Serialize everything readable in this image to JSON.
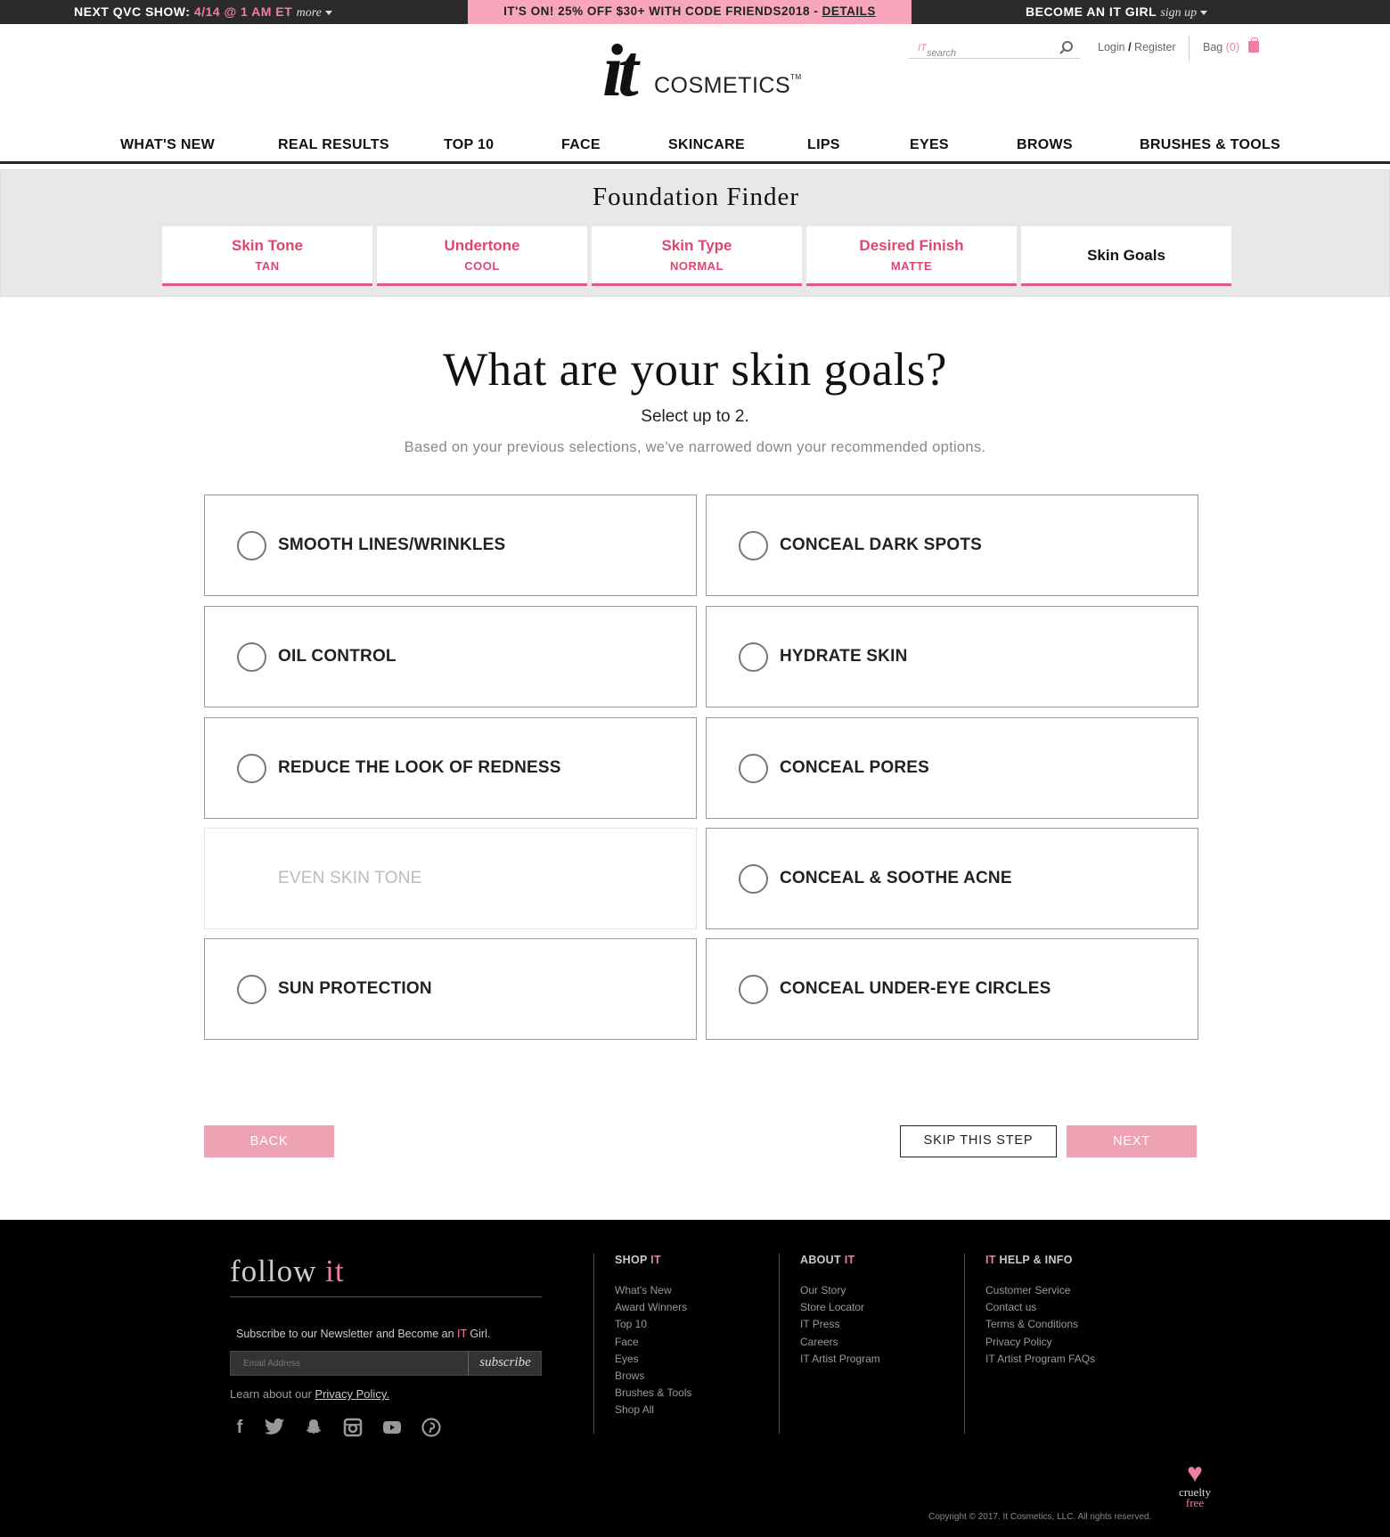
{
  "topbar": {
    "qvc_label": "NEXT QVC SHOW:",
    "qvc_date": "4/14 @ 1 AM ET",
    "qvc_more": "more",
    "promo_text": "IT'S ON! 25% OFF $30+ WITH CODE FRIENDS2018 - ",
    "promo_link": "DETAILS",
    "itgirl_label": "BECOME AN IT GIRL",
    "itgirl_signup": "sign up"
  },
  "header": {
    "logo_it": "it",
    "logo_cosmetics": "COSMETICS",
    "logo_tm": "TM",
    "search_placeholder": "search",
    "search_brand": "IT",
    "login": "Login",
    "slash": "/",
    "register": "Register",
    "bag": "Bag",
    "bag_count": "(0)"
  },
  "nav": [
    "WHAT'S NEW",
    "REAL RESULTS",
    "TOP 10",
    "FACE",
    "SKINCARE",
    "LIPS",
    "EYES",
    "BROWS",
    "BRUSHES & TOOLS"
  ],
  "finder": {
    "title": "Foundation Finder",
    "steps": [
      {
        "title": "Skin Tone",
        "value": "TAN"
      },
      {
        "title": "Undertone",
        "value": "COOL"
      },
      {
        "title": "Skin Type",
        "value": "NORMAL"
      },
      {
        "title": "Desired Finish",
        "value": "MATTE"
      },
      {
        "title": "Skin Goals",
        "value": ""
      }
    ]
  },
  "question": {
    "title": "What are your skin goals?",
    "instruction": "Select up to 2.",
    "note": "Based on your previous selections, we've narrowed down your recommended options."
  },
  "options": [
    {
      "label": "SMOOTH LINES/WRINKLES",
      "enabled": true
    },
    {
      "label": "CONCEAL DARK SPOTS",
      "enabled": true
    },
    {
      "label": "OIL CONTROL",
      "enabled": true
    },
    {
      "label": "HYDRATE SKIN",
      "enabled": true
    },
    {
      "label": "REDUCE THE LOOK OF REDNESS",
      "enabled": true
    },
    {
      "label": "CONCEAL PORES",
      "enabled": true
    },
    {
      "label": "EVEN SKIN TONE",
      "enabled": false
    },
    {
      "label": "CONCEAL & SOOTHE ACNE",
      "enabled": true
    },
    {
      "label": "SUN PROTECTION",
      "enabled": true
    },
    {
      "label": "CONCEAL UNDER-EYE CIRCLES",
      "enabled": true
    }
  ],
  "actions": {
    "back": "BACK",
    "skip": "SKIP THIS STEP",
    "next": "NEXT"
  },
  "footer": {
    "follow": "follow",
    "follow_it": "it",
    "newsletter_pre": "Subscribe to our Newsletter and Become an ",
    "newsletter_it": "IT",
    "newsletter_post": " Girl.",
    "email_placeholder": "Email Address",
    "subscribe": "subscribe",
    "privacy_pre": "Learn about our ",
    "privacy_link": "Privacy Policy.",
    "social": [
      "facebook-icon",
      "twitter-icon",
      "snapchat-icon",
      "instagram-icon",
      "youtube-icon",
      "pinterest-icon"
    ],
    "columns": [
      {
        "heading_pre": "SHOP ",
        "heading_it": "IT",
        "heading_post": "",
        "links": [
          "What's New",
          "Award Winners",
          "Top 10",
          "Face",
          "Eyes",
          "Brows",
          "Brushes & Tools",
          "Shop All"
        ]
      },
      {
        "heading_pre": "ABOUT ",
        "heading_it": "IT",
        "heading_post": "",
        "links": [
          "Our Story",
          "Store Locator",
          "IT Press",
          "Careers",
          "IT Artist Program"
        ]
      },
      {
        "heading_pre": "",
        "heading_it": "IT",
        "heading_post": " HELP & INFO",
        "links": [
          "Customer Service",
          "Contact us",
          "Terms & Conditions",
          "Privacy Policy",
          "IT Artist Program FAQs"
        ]
      }
    ],
    "cruelty_1": "cruelty",
    "cruelty_2": "free",
    "copyright": "Copyright © 2017. It Cosmetics, LLC. All rights reserved."
  },
  "colors": {
    "accent": "#e0456f",
    "promo_bg": "#f7a6bd",
    "button_pink": "#eda3b3"
  }
}
